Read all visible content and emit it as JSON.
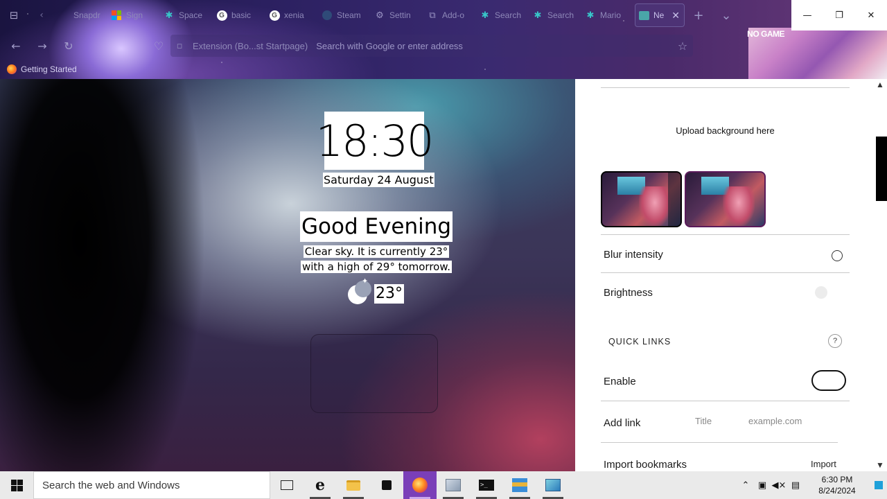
{
  "browser": {
    "tabs": [
      {
        "title": "Snapdr",
        "icon": "tab-icon-generic",
        "active": false
      },
      {
        "title": "Sign",
        "icon": "microsoft-icon",
        "active": false
      },
      {
        "title": "Space",
        "icon": "star-icon",
        "active": false
      },
      {
        "title": "basic",
        "icon": "google-icon",
        "active": false
      },
      {
        "title": "xenia",
        "icon": "google-icon",
        "active": false
      },
      {
        "title": "Steam",
        "icon": "steam-icon",
        "active": false
      },
      {
        "title": "Settin",
        "icon": "gear-icon",
        "active": false
      },
      {
        "title": "Add-o",
        "icon": "puzzle-icon",
        "active": false
      },
      {
        "title": "Search",
        "icon": "star-icon",
        "active": false
      },
      {
        "title": "Search",
        "icon": "star-icon",
        "active": false
      },
      {
        "title": "Mario",
        "icon": "star-icon",
        "active": false
      },
      {
        "title": "Ne",
        "icon": "newtab-icon",
        "active": true
      }
    ],
    "window_controls": {
      "minimize": "—",
      "restore": "❐",
      "close": "✕"
    },
    "urlbar": {
      "identity": "Extension (Bo...st Startpage)",
      "placeholder": "Search with Google or enter address"
    },
    "bookmarks": [
      {
        "label": "Getting Started"
      }
    ],
    "theme_logo": "NO GAME"
  },
  "newtab": {
    "time": "18:30",
    "date": "Saturday 24 August",
    "greeting": "Good Evening",
    "weather_line1": "Clear sky. It is currently 23°",
    "weather_line2": "with a high of 29° tomorrow.",
    "temperature": "23°",
    "weather_icon": "moon-stars-icon"
  },
  "settings": {
    "upload_text": "Upload background here",
    "blur_label": "Blur intensity",
    "brightness_label": "Brightness",
    "quick_links_title": "QUICK LINKS",
    "help_label": "?",
    "enable_label": "Enable",
    "add_link_label": "Add link",
    "title_placeholder": "Title",
    "url_placeholder": "example.com",
    "import_bookmarks_label": "Import bookmarks",
    "import_button": "Import"
  },
  "taskbar": {
    "search_placeholder": "Search the web and Windows",
    "time": "6:30 PM",
    "date": "8/24/2024",
    "apps": [
      {
        "name": "task-view",
        "running": false
      },
      {
        "name": "edge",
        "running": true
      },
      {
        "name": "file-explorer",
        "running": true
      },
      {
        "name": "store",
        "running": false
      },
      {
        "name": "firefox",
        "running": true,
        "active": true
      },
      {
        "name": "app-window",
        "running": true
      },
      {
        "name": "terminal",
        "running": true
      },
      {
        "name": "app-blue",
        "running": true
      },
      {
        "name": "app-screen",
        "running": true
      }
    ]
  }
}
